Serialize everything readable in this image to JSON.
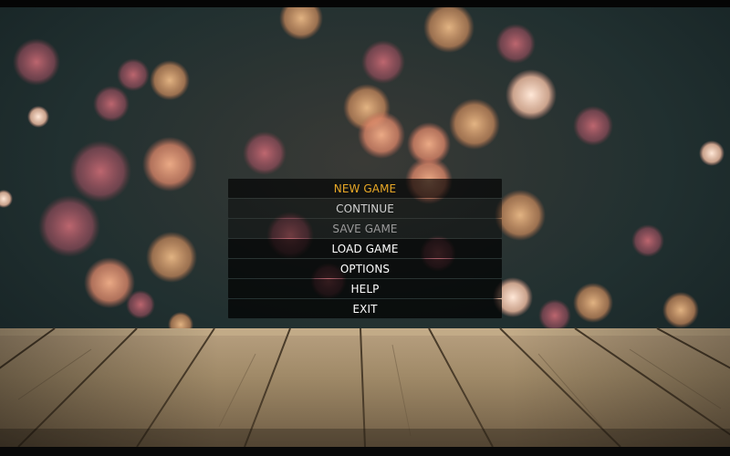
{
  "menu": {
    "items": [
      {
        "label": "NEW GAME",
        "state": "selected"
      },
      {
        "label": "CONTINUE",
        "state": "normal"
      },
      {
        "label": "SAVE GAME",
        "state": "disabled"
      },
      {
        "label": "LOAD GAME",
        "state": "normal"
      },
      {
        "label": "OPTIONS",
        "state": "normal"
      },
      {
        "label": "HELP",
        "state": "normal"
      },
      {
        "label": "EXIT",
        "state": "normal"
      }
    ],
    "highlight_color": "#e8a826",
    "text_color": "#ffffff",
    "disabled_color": "#9a9a9a"
  },
  "background": {
    "bokeh_color": "#e0906a",
    "backdrop_color": "#1e2a2a",
    "wood_color": "#a08a6a"
  }
}
